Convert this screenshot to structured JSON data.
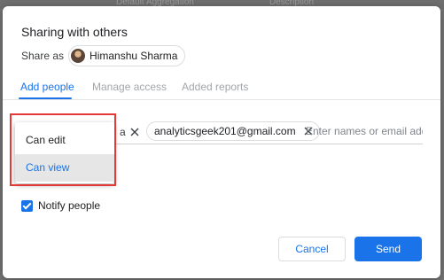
{
  "background": {
    "partial_labels": [
      "Default Aggregation",
      "Description"
    ]
  },
  "dialog": {
    "title": "Sharing with others",
    "share_as_label": "Share as",
    "user_name": "Himanshu Sharma"
  },
  "tabs": [
    {
      "label": "Add people",
      "active": true
    },
    {
      "label": "Manage access",
      "active": false
    },
    {
      "label": "Added reports",
      "active": false
    }
  ],
  "recipients": {
    "partial_chip_tail": "a",
    "email_chip": "analyticsgeek201@gmail.com",
    "input_placeholder": "Enter names or email addr",
    "input_value": ""
  },
  "permission_menu": {
    "options": [
      "Can edit",
      "Can view"
    ],
    "highlighted": "Can view"
  },
  "notify": {
    "label": "Notify people",
    "checked": true
  },
  "buttons": {
    "cancel": "Cancel",
    "send": "Send"
  },
  "colors": {
    "accent": "#1a73e8",
    "highlight_border": "#e53935",
    "overlay": "#757575"
  }
}
